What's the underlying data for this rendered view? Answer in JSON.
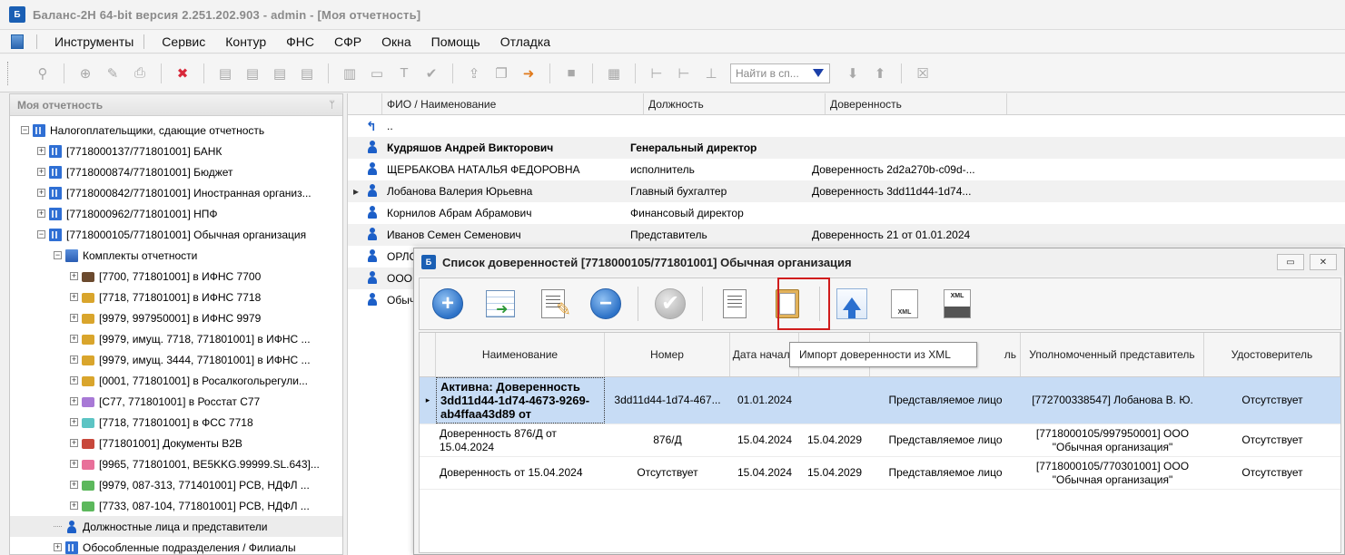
{
  "window": {
    "title": "Баланс-2Н 64-bit версия 2.251.202.903 - admin - [Моя отчетность]"
  },
  "menu": [
    "Инструменты",
    "Сервис",
    "Контур",
    "ФНС",
    "СФР",
    "Окна",
    "Помощь",
    "Отладка"
  ],
  "toolbar": {
    "search_placeholder": "Найти в сп..."
  },
  "left_panel": {
    "title": "Моя отчетность",
    "tree": [
      {
        "label": "Налогоплательщики, сдающие отчетность",
        "level": 0,
        "icon": "org-icon",
        "expanded": true
      },
      {
        "label": "[7718000137/771801001] БАНК",
        "level": 1,
        "icon": "building-icon"
      },
      {
        "label": "[7718000874/771801001] Бюджет",
        "level": 1,
        "icon": "building-icon"
      },
      {
        "label": "[7718000842/771801001] Иностранная организ...",
        "level": 1,
        "icon": "building-icon"
      },
      {
        "label": "[7718000962/771801001] НПФ",
        "level": 1,
        "icon": "building-icon"
      },
      {
        "label": "[7718000105/771801001] Обычная организация",
        "level": 1,
        "icon": "building-icon",
        "expanded": true
      },
      {
        "label": "Комплекты отчетности",
        "level": 2,
        "icon": "report-sets-icon",
        "expanded": true
      },
      {
        "label": "[7700, 771801001] в ИФНС 7700",
        "level": 3,
        "icon": "folder-icon",
        "color": "#6b4a2e"
      },
      {
        "label": "[7718, 771801001] в ИФНС 7718",
        "level": 3,
        "icon": "folder-icon",
        "color": "#d9a52c"
      },
      {
        "label": "[9979, 997950001] в ИФНС 9979",
        "level": 3,
        "icon": "folder-icon",
        "color": "#d9a52c"
      },
      {
        "label": "[9979, имущ. 7718, 771801001] в ИФНС ...",
        "level": 3,
        "icon": "folder-icon",
        "color": "#d9a52c"
      },
      {
        "label": "[9979, имущ. 3444, 771801001] в ИФНС ...",
        "level": 3,
        "icon": "folder-icon",
        "color": "#d9a52c"
      },
      {
        "label": "[0001, 771801001] в Росалкогольрегули...",
        "level": 3,
        "icon": "folder-icon",
        "color": "#d9a52c"
      },
      {
        "label": "[C77, 771801001] в Росстат C77",
        "level": 3,
        "icon": "folder-icon",
        "color": "#a879d6"
      },
      {
        "label": "[7718, 771801001] в ФСС 7718",
        "level": 3,
        "icon": "folder-icon",
        "color": "#5cc4c4"
      },
      {
        "label": "[771801001] Документы B2B",
        "level": 3,
        "icon": "folder-icon",
        "color": "#c8483b"
      },
      {
        "label": "[9965, 771801001, BE5KKG.99999.SL.643]...",
        "level": 3,
        "icon": "folder-icon",
        "color": "#e8709a"
      },
      {
        "label": "[9979, 087-313, 771401001] РСВ, НДФЛ ...",
        "level": 3,
        "icon": "folder-icon",
        "color": "#5cb85c"
      },
      {
        "label": "[7733, 087-104, 771801001] РСВ, НДФЛ ...",
        "level": 3,
        "icon": "folder-icon",
        "color": "#5cb85c"
      },
      {
        "label": "Должностные лица и представители",
        "level": 2,
        "icon": "person-icon",
        "leaf": true,
        "selected": true
      },
      {
        "label": "Обособленные подразделения / Филиалы",
        "level": 2,
        "icon": "branches-icon"
      }
    ]
  },
  "main_grid": {
    "columns": [
      "ФИО / Наименование",
      "Должность",
      "Доверенность"
    ],
    "rows": [
      {
        "name": "..",
        "position": "",
        "poa": "",
        "icon": "up-icon"
      },
      {
        "name": "Кудряшов Андрей Викторович",
        "position": "Генеральный директор",
        "poa": "",
        "bold": true
      },
      {
        "name": "ЩЕРБАКОВА НАТАЛЬЯ ФЕДОРОВНА",
        "position": "исполнитель",
        "poa": "Доверенность 2d2a270b-c09d-..."
      },
      {
        "name": "Лобанова Валерия Юрьевна",
        "position": "Главный бухгалтер",
        "poa": "Доверенность  3dd11d44-1d74...",
        "current": true
      },
      {
        "name": "Корнилов Абрам Абрамович",
        "position": "Финансовый директор",
        "poa": ""
      },
      {
        "name": "Иванов Семен Семенович",
        "position": "Представитель",
        "poa": "Доверенность 21 от 01.01.2024"
      },
      {
        "name": "ОРЛО",
        "position": "",
        "poa": ""
      },
      {
        "name": "ООО",
        "position": "",
        "poa": ""
      },
      {
        "name": "Обыч",
        "position": "",
        "poa": ""
      }
    ]
  },
  "dialog": {
    "title": "Список доверенностей [7718000105/771801001] Обычная организация",
    "columns": [
      "Наименование",
      "Номер",
      "Дата начала",
      "",
      "ль",
      "Уполномоченный представитель",
      "Удостоверитель"
    ],
    "rows": [
      {
        "name": "Активна: Доверенность 3dd11d44-1d74-4673-9269-ab4ffaa43d89 от",
        "number": "3dd11d44-1d74-467...",
        "start": "01.01.2024",
        "end": "",
        "principal": "Представляемое лицо",
        "representative": "[772700338547] Лобанова В. Ю.",
        "certifier": "Отсутствует",
        "active": true
      },
      {
        "name": "Доверенность 876/Д от 15.04.2024",
        "number": "876/Д",
        "start": "15.04.2024",
        "end": "15.04.2029",
        "principal": "Представляемое лицо",
        "representative": "[7718000105/997950001] ООО \"Обычная организация\"",
        "certifier": "Отсутствует"
      },
      {
        "name": "Доверенность от 15.04.2024",
        "number": "Отсутствует",
        "start": "15.04.2024",
        "end": "15.04.2029",
        "principal": "Представляемое лицо",
        "representative": "[7718000105/770301001] ООО \"Обычная организация\"",
        "certifier": "Отсутствует"
      }
    ],
    "tooltip": "Импорт доверенности из XML",
    "toolbar_buttons": [
      "add-icon",
      "table-import-icon",
      "edit-icon",
      "remove-icon",
      "check-icon",
      "document-icon",
      "clipboard-icon",
      "import-xml-icon",
      "export-xml-icon",
      "save-xml-icon"
    ]
  },
  "colors": {
    "accent": "#2d72c7",
    "selection": "#c7dcf5",
    "highlight_box": "#d01c1c",
    "delete": "#d8283a"
  }
}
